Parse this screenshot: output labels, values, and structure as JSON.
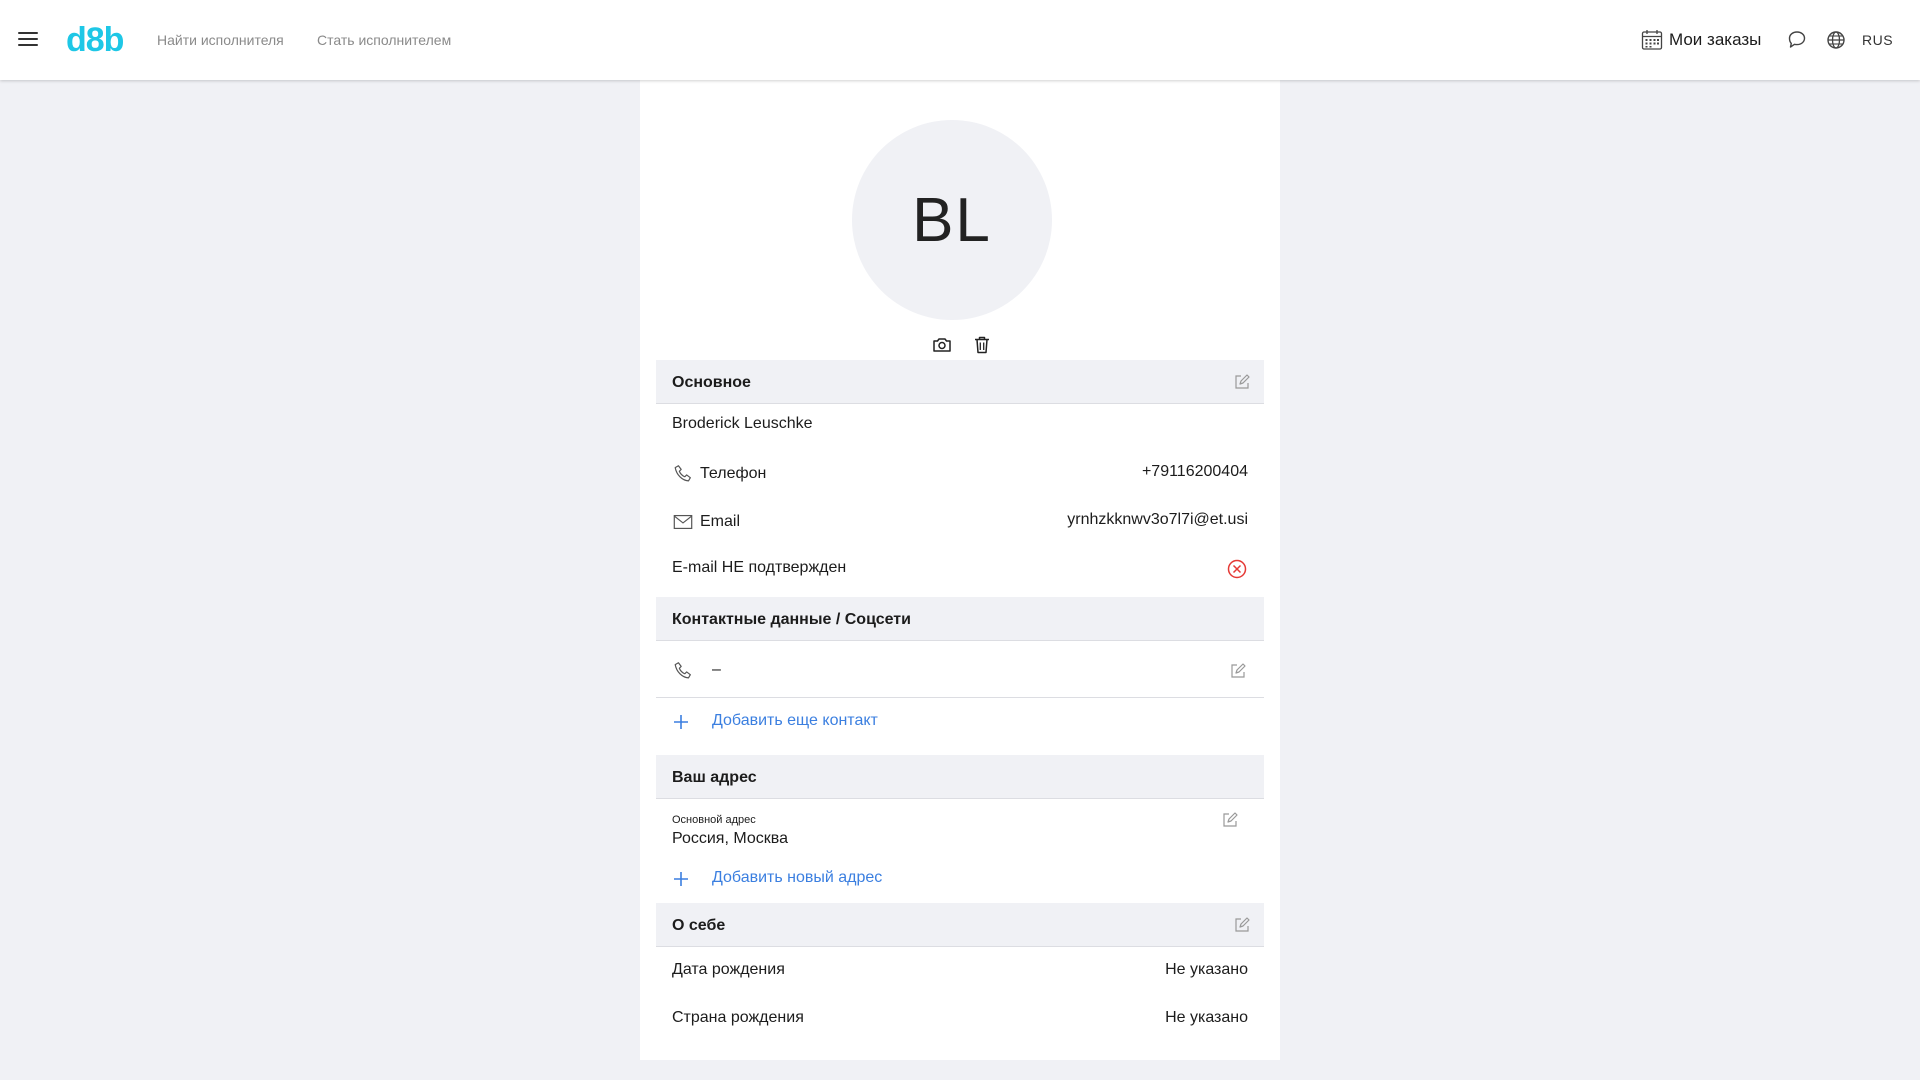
{
  "header": {
    "logo": "d8b",
    "nav": [
      "Найти исполнителя",
      "Стать исполнителем"
    ],
    "orders_label": "Мои заказы",
    "lang": "RUS"
  },
  "profile": {
    "initials": "BL",
    "main": {
      "title": "Основное",
      "name": "Broderick Leuschke",
      "phone_label": "Телефон",
      "phone_value": "+79116200404",
      "email_label": "Email",
      "email_value": "yrnhzkknwv3o7l7i@et.usi",
      "email_status": "E-mail НЕ подтвержден"
    },
    "contacts": {
      "title": "Контактные данные / Соцсети",
      "phone_value": "–",
      "add_label": "Добавить еще контакт"
    },
    "address": {
      "title": "Ваш адрес",
      "caption": "Основной адрес",
      "value": "Россия, Москва",
      "add_label": "Добавить новый адрес"
    },
    "about": {
      "title": "О себе",
      "birth_date_label": "Дата рождения",
      "birth_date_value": "Не указано",
      "birth_country_label": "Страна рождения",
      "birth_country_value": "Не указано"
    }
  },
  "colors": {
    "brand": "#1ec7e6",
    "link": "#3b7fe0",
    "error": "#e53935",
    "section_bg": "#f0f1f5"
  },
  "icons": [
    "menu-icon",
    "calendar-icon",
    "chat-icon",
    "globe-icon",
    "camera-icon",
    "trash-icon",
    "edit-icon",
    "phone-icon",
    "mail-icon",
    "close-circle-icon",
    "plus-icon"
  ]
}
